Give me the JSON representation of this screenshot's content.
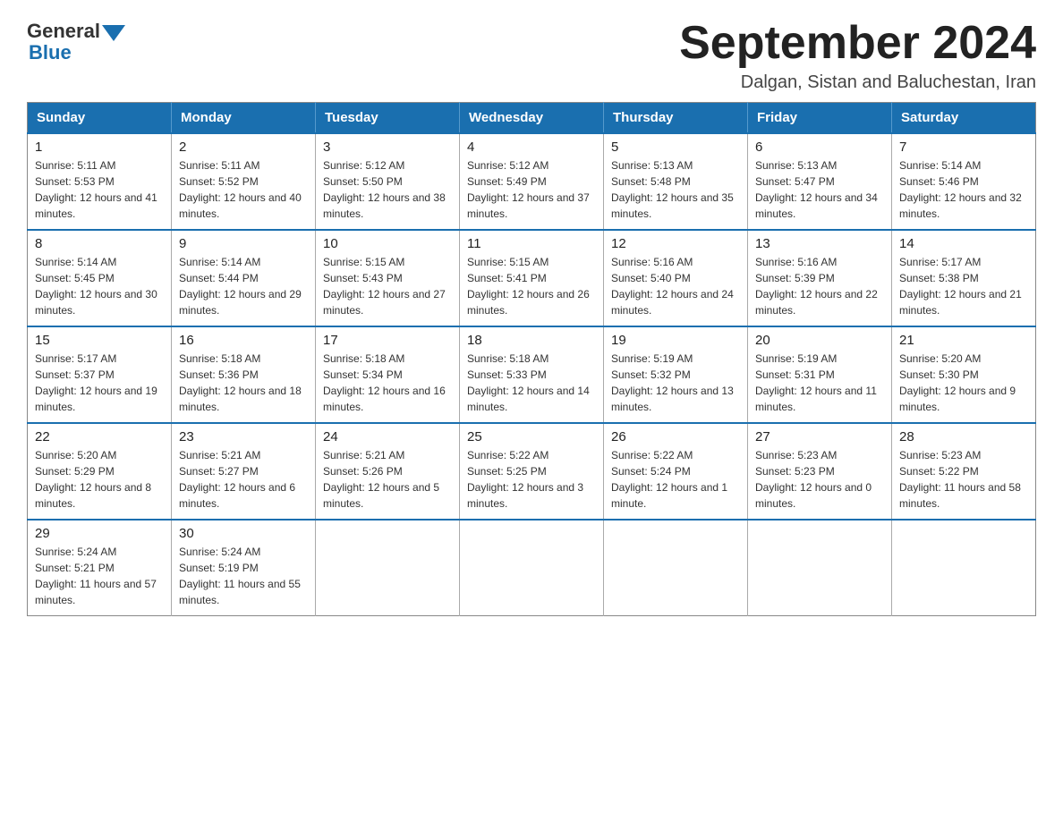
{
  "header": {
    "logo": {
      "text_general": "General",
      "text_blue": "Blue",
      "aria": "GeneralBlue logo"
    },
    "title": "September 2024",
    "subtitle": "Dalgan, Sistan and Baluchestan, Iran"
  },
  "calendar": {
    "days_of_week": [
      "Sunday",
      "Monday",
      "Tuesday",
      "Wednesday",
      "Thursday",
      "Friday",
      "Saturday"
    ],
    "weeks": [
      [
        {
          "date": "1",
          "sunrise": "5:11 AM",
          "sunset": "5:53 PM",
          "daylight": "12 hours and 41 minutes."
        },
        {
          "date": "2",
          "sunrise": "5:11 AM",
          "sunset": "5:52 PM",
          "daylight": "12 hours and 40 minutes."
        },
        {
          "date": "3",
          "sunrise": "5:12 AM",
          "sunset": "5:50 PM",
          "daylight": "12 hours and 38 minutes."
        },
        {
          "date": "4",
          "sunrise": "5:12 AM",
          "sunset": "5:49 PM",
          "daylight": "12 hours and 37 minutes."
        },
        {
          "date": "5",
          "sunrise": "5:13 AM",
          "sunset": "5:48 PM",
          "daylight": "12 hours and 35 minutes."
        },
        {
          "date": "6",
          "sunrise": "5:13 AM",
          "sunset": "5:47 PM",
          "daylight": "12 hours and 34 minutes."
        },
        {
          "date": "7",
          "sunrise": "5:14 AM",
          "sunset": "5:46 PM",
          "daylight": "12 hours and 32 minutes."
        }
      ],
      [
        {
          "date": "8",
          "sunrise": "5:14 AM",
          "sunset": "5:45 PM",
          "daylight": "12 hours and 30 minutes."
        },
        {
          "date": "9",
          "sunrise": "5:14 AM",
          "sunset": "5:44 PM",
          "daylight": "12 hours and 29 minutes."
        },
        {
          "date": "10",
          "sunrise": "5:15 AM",
          "sunset": "5:43 PM",
          "daylight": "12 hours and 27 minutes."
        },
        {
          "date": "11",
          "sunrise": "5:15 AM",
          "sunset": "5:41 PM",
          "daylight": "12 hours and 26 minutes."
        },
        {
          "date": "12",
          "sunrise": "5:16 AM",
          "sunset": "5:40 PM",
          "daylight": "12 hours and 24 minutes."
        },
        {
          "date": "13",
          "sunrise": "5:16 AM",
          "sunset": "5:39 PM",
          "daylight": "12 hours and 22 minutes."
        },
        {
          "date": "14",
          "sunrise": "5:17 AM",
          "sunset": "5:38 PM",
          "daylight": "12 hours and 21 minutes."
        }
      ],
      [
        {
          "date": "15",
          "sunrise": "5:17 AM",
          "sunset": "5:37 PM",
          "daylight": "12 hours and 19 minutes."
        },
        {
          "date": "16",
          "sunrise": "5:18 AM",
          "sunset": "5:36 PM",
          "daylight": "12 hours and 18 minutes."
        },
        {
          "date": "17",
          "sunrise": "5:18 AM",
          "sunset": "5:34 PM",
          "daylight": "12 hours and 16 minutes."
        },
        {
          "date": "18",
          "sunrise": "5:18 AM",
          "sunset": "5:33 PM",
          "daylight": "12 hours and 14 minutes."
        },
        {
          "date": "19",
          "sunrise": "5:19 AM",
          "sunset": "5:32 PM",
          "daylight": "12 hours and 13 minutes."
        },
        {
          "date": "20",
          "sunrise": "5:19 AM",
          "sunset": "5:31 PM",
          "daylight": "12 hours and 11 minutes."
        },
        {
          "date": "21",
          "sunrise": "5:20 AM",
          "sunset": "5:30 PM",
          "daylight": "12 hours and 9 minutes."
        }
      ],
      [
        {
          "date": "22",
          "sunrise": "5:20 AM",
          "sunset": "5:29 PM",
          "daylight": "12 hours and 8 minutes."
        },
        {
          "date": "23",
          "sunrise": "5:21 AM",
          "sunset": "5:27 PM",
          "daylight": "12 hours and 6 minutes."
        },
        {
          "date": "24",
          "sunrise": "5:21 AM",
          "sunset": "5:26 PM",
          "daylight": "12 hours and 5 minutes."
        },
        {
          "date": "25",
          "sunrise": "5:22 AM",
          "sunset": "5:25 PM",
          "daylight": "12 hours and 3 minutes."
        },
        {
          "date": "26",
          "sunrise": "5:22 AM",
          "sunset": "5:24 PM",
          "daylight": "12 hours and 1 minute."
        },
        {
          "date": "27",
          "sunrise": "5:23 AM",
          "sunset": "5:23 PM",
          "daylight": "12 hours and 0 minutes."
        },
        {
          "date": "28",
          "sunrise": "5:23 AM",
          "sunset": "5:22 PM",
          "daylight": "11 hours and 58 minutes."
        }
      ],
      [
        {
          "date": "29",
          "sunrise": "5:24 AM",
          "sunset": "5:21 PM",
          "daylight": "11 hours and 57 minutes."
        },
        {
          "date": "30",
          "sunrise": "5:24 AM",
          "sunset": "5:19 PM",
          "daylight": "11 hours and 55 minutes."
        },
        null,
        null,
        null,
        null,
        null
      ]
    ]
  }
}
